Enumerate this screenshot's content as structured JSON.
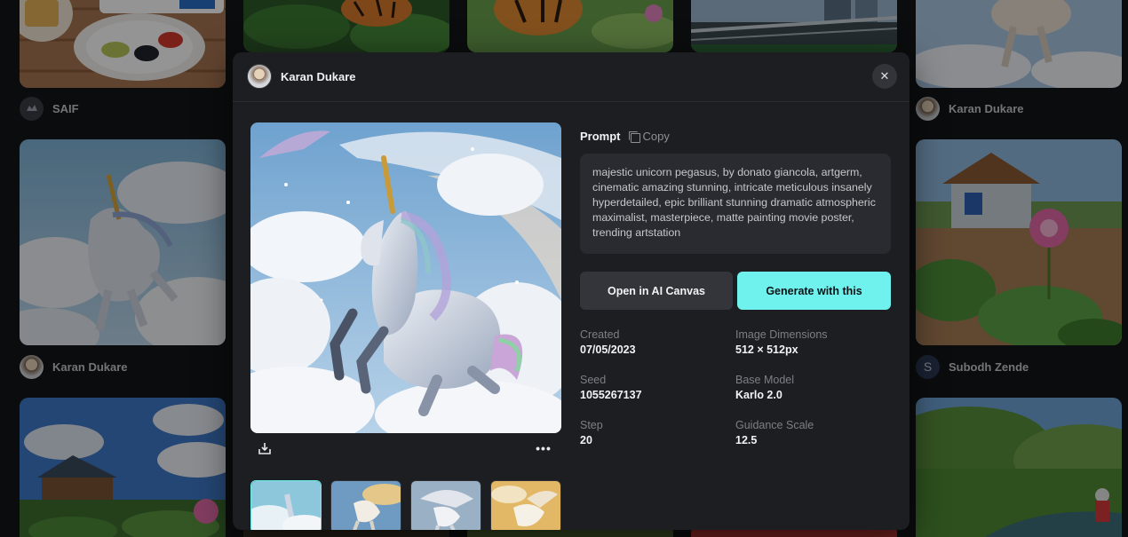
{
  "gallery": {
    "authors": [
      {
        "name": "SAIF",
        "avatar": ""
      },
      {
        "name": "Karan Dukare",
        "avatar": ""
      },
      {
        "name": "Karan Dukare",
        "avatar": ""
      },
      {
        "name": "Subodh Zende",
        "avatar": "S"
      }
    ]
  },
  "modal": {
    "author": {
      "name": "Karan Dukare"
    },
    "close_label": "✕",
    "prompt_label": "Prompt",
    "copy_label": "Copy",
    "prompt_text": "majestic unicorn pegasus, by donato giancola, artgerm, cinematic amazing stunning, intricate meticulous insanely hyperdetailed, epic brilliant stunning dramatic atmospheric maximalist, masterpiece, matte painting movie poster, trending artstation",
    "buttons": {
      "open_canvas": "Open in AI Canvas",
      "generate": "Generate with this"
    },
    "more_label": "•••",
    "meta": {
      "created": {
        "label": "Created",
        "value": "07/05/2023"
      },
      "dimensions": {
        "label": "Image Dimensions",
        "value": "512 × 512px"
      },
      "seed": {
        "label": "Seed",
        "value": "1055267137"
      },
      "model": {
        "label": "Base Model",
        "value": "Karlo 2.0"
      },
      "step": {
        "label": "Step",
        "value": "20"
      },
      "guidance": {
        "label": "Guidance Scale",
        "value": "12.5"
      }
    }
  },
  "colors": {
    "accent": "#6ff2ee",
    "background": "#141518",
    "modal": "#1d1e22"
  },
  "icons": [
    "close-icon",
    "copy-icon",
    "download-icon",
    "more-icon"
  ]
}
